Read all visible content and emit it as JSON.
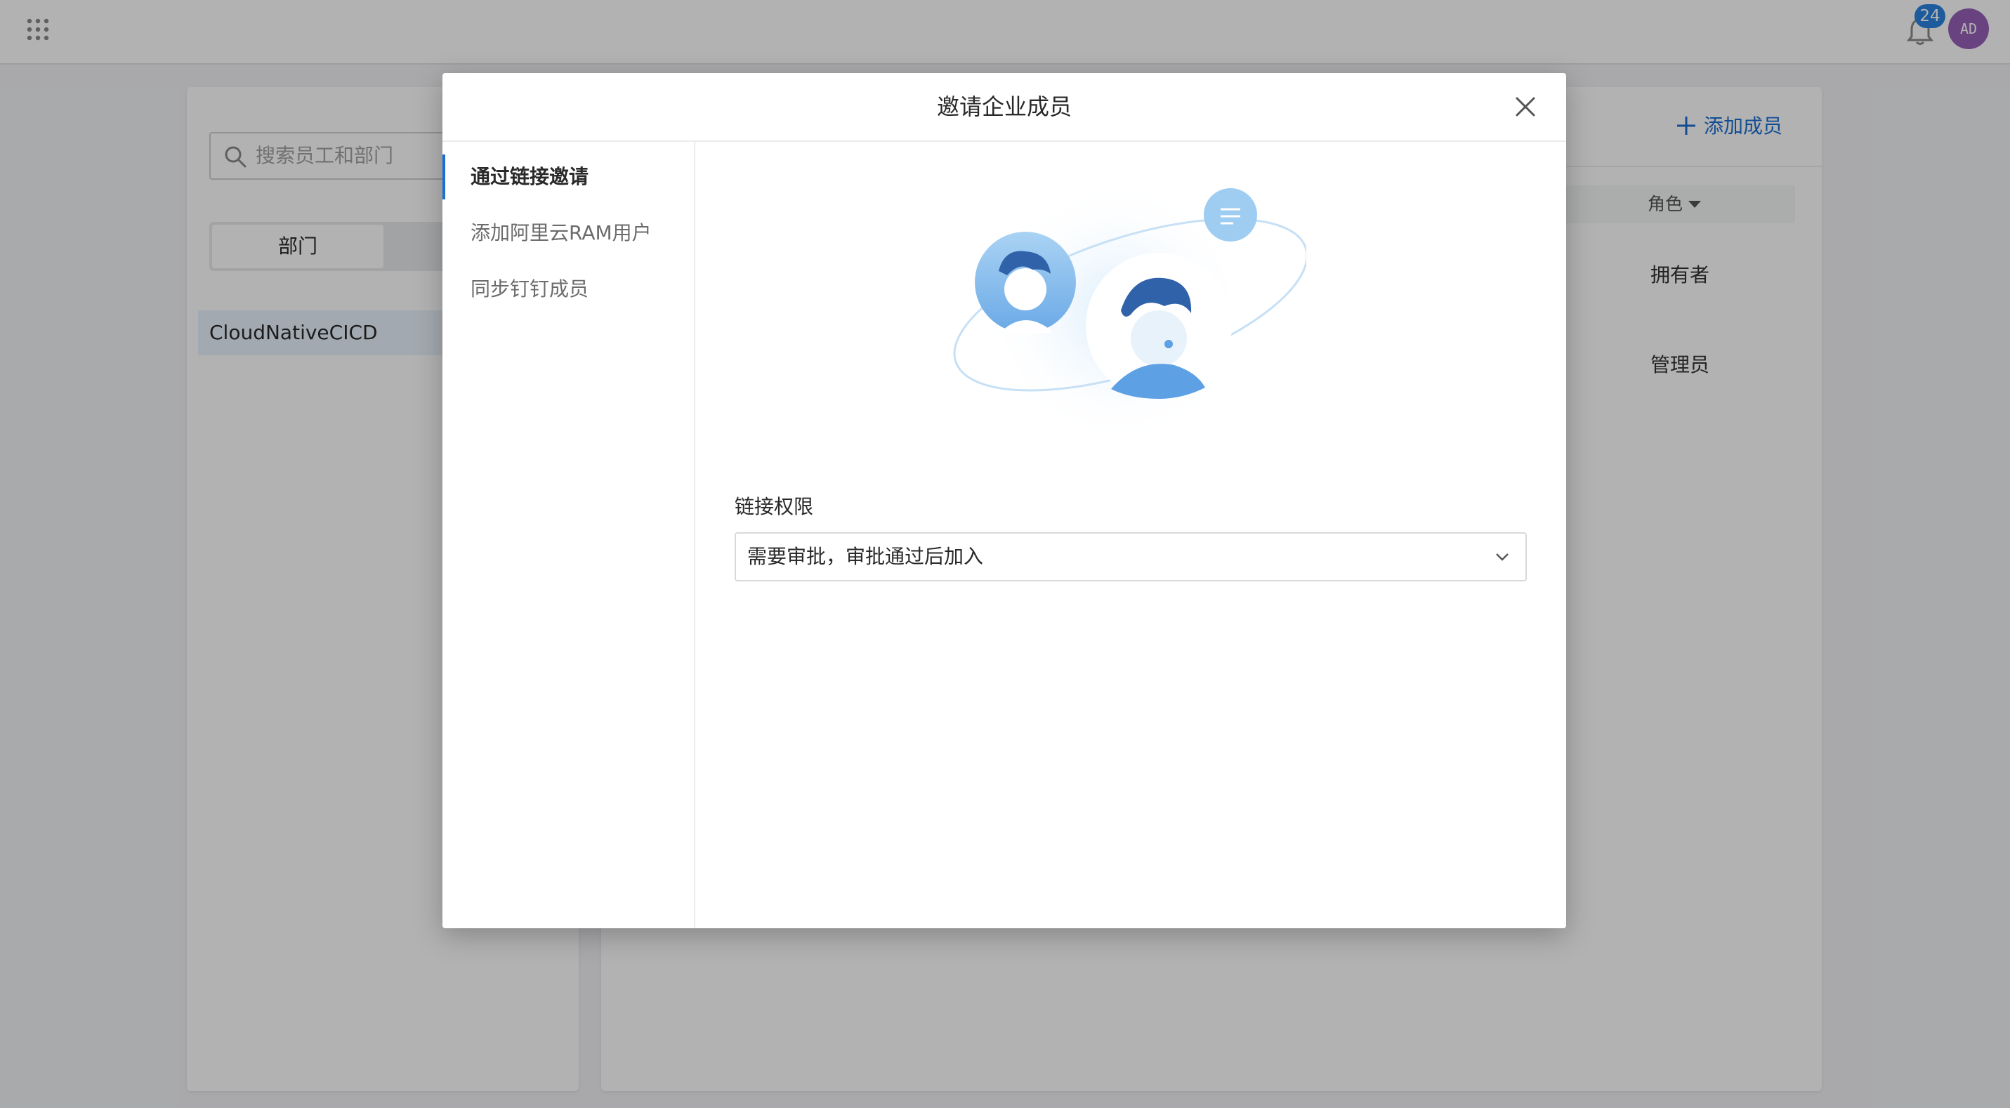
{
  "topbar": {
    "notification_count": "24",
    "avatar_initials": "AD"
  },
  "left_panel": {
    "search_placeholder": "搜索员工和部门",
    "segment_active": "部门",
    "org_name": "CloudNativeCICD"
  },
  "main_panel": {
    "add_member_label": "添加成员",
    "role_column_header": "角色",
    "roles": [
      "拥有者",
      "管理员"
    ]
  },
  "modal": {
    "title": "邀请企业成员",
    "side_items": [
      {
        "label": "通过链接邀请",
        "active": true
      },
      {
        "label": "添加阿里云RAM用户",
        "active": false
      },
      {
        "label": "同步钉钉成员",
        "active": false
      }
    ],
    "permission_label": "链接权限",
    "permission_value": "需要审批，审批通过后加入"
  },
  "colors": {
    "accent": "#1b6fd4",
    "avatar_bg": "#9561b8",
    "badge_bg": "#2a83e0"
  }
}
